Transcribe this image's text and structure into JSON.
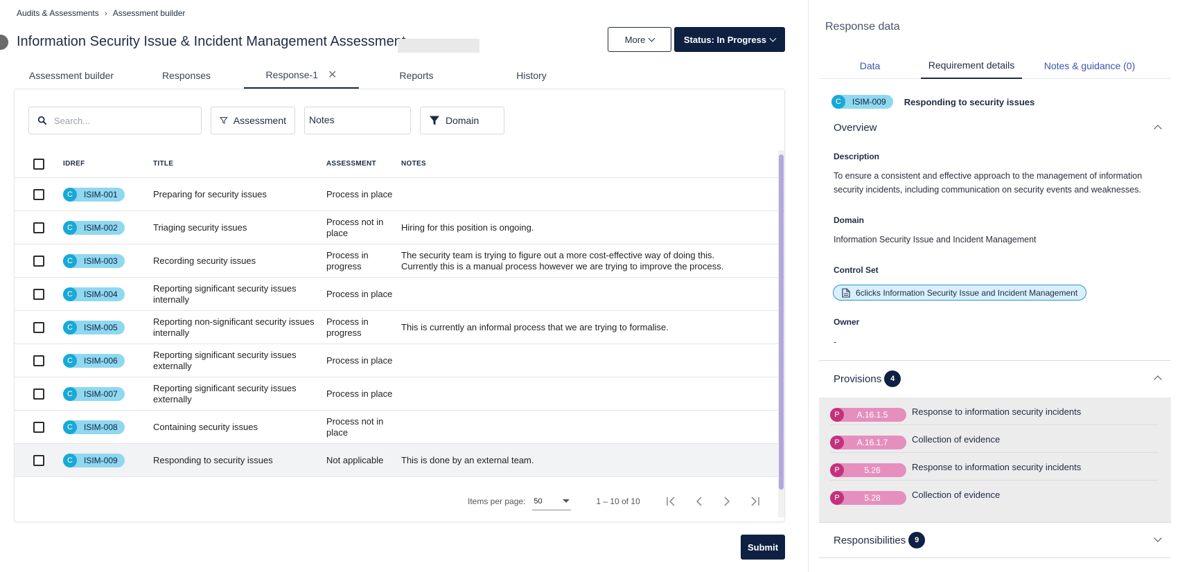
{
  "breadcrumb": {
    "parent": "Audits & Assessments",
    "current": "Assessment builder"
  },
  "page_title": "Information Security Issue & Incident Management Assessment",
  "header_buttons": {
    "more": "More",
    "status": "Status: In Progress"
  },
  "tabs": [
    {
      "label": "Assessment builder"
    },
    {
      "label": "Responses"
    },
    {
      "label": "Response-1",
      "close": "✕"
    },
    {
      "label": "Reports"
    },
    {
      "label": "History"
    }
  ],
  "filters": {
    "search_placeholder": "Search...",
    "assessment": "Assessment",
    "notes": "Notes",
    "domain": "Domain"
  },
  "table": {
    "headers": {
      "idref": "IDREF",
      "title": "TITLE",
      "assessment": "ASSESSMENT",
      "notes": "NOTES"
    },
    "rows": [
      {
        "letter": "C",
        "id": "ISIM-001",
        "title": "Preparing for security issues",
        "assessment": "Process in place",
        "notes": ""
      },
      {
        "letter": "C",
        "id": "ISIM-002",
        "title": "Triaging security issues",
        "assessment": "Process not in place",
        "notes": "Hiring for this position is ongoing."
      },
      {
        "letter": "C",
        "id": "ISIM-003",
        "title": "Recording security issues",
        "assessment": "Process in progress",
        "notes": "The security team is trying to figure out a more cost-effective way of doing this. Currently this is a manual process however we are trying to improve the process."
      },
      {
        "letter": "C",
        "id": "ISIM-004",
        "title": "Reporting significant security issues internally",
        "assessment": "Process in place",
        "notes": ""
      },
      {
        "letter": "C",
        "id": "ISIM-005",
        "title": "Reporting non-significant security issues internally",
        "assessment": "Process in progress",
        "notes": "This is currently an informal process that we are trying to formalise."
      },
      {
        "letter": "C",
        "id": "ISIM-006",
        "title": "Reporting significant security issues externally",
        "assessment": "Process in place",
        "notes": ""
      },
      {
        "letter": "C",
        "id": "ISIM-007",
        "title": "Reporting significant security issues externally",
        "assessment": "Process in place",
        "notes": ""
      },
      {
        "letter": "C",
        "id": "ISIM-008",
        "title": "Containing security issues",
        "assessment": "Process not in place",
        "notes": ""
      },
      {
        "letter": "C",
        "id": "ISIM-009",
        "title": "Responding to security issues",
        "assessment": "Not applicable",
        "notes": "This is done by an external team."
      }
    ]
  },
  "paginator": {
    "items_label": "Items per page:",
    "per_page": "50",
    "range": "1 – 10 of 10"
  },
  "submit_label": "Submit",
  "right_panel": {
    "title": "Response data",
    "tabs": [
      {
        "label": "Data"
      },
      {
        "label": "Requirement details"
      },
      {
        "label": "Notes & guidance (0)"
      }
    ],
    "requirement": {
      "letter": "C",
      "id": "ISIM-009",
      "title": "Responding to security issues"
    },
    "overview": {
      "heading": "Overview",
      "description_label": "Description",
      "description": "To ensure a consistent and effective approach to the management of information security incidents, including communication on security events and weaknesses.",
      "domain_label": "Domain",
      "domain": "Information Security Issue and Incident Management",
      "control_set_label": "Control Set",
      "control_set": "6clicks Information Security Issue and Incident Management",
      "owner_label": "Owner",
      "owner": "-"
    },
    "provisions": {
      "heading": "Provisions",
      "count": "4",
      "items": [
        {
          "letter": "P",
          "code": "A.16.1.5",
          "text": "Response to information security incidents"
        },
        {
          "letter": "P",
          "code": "A.16.1.7",
          "text": "Collection of evidence"
        },
        {
          "letter": "P",
          "code": "5.26",
          "text": "Response to information security incidents"
        },
        {
          "letter": "P",
          "code": "5.28",
          "text": "Collection of evidence"
        }
      ]
    },
    "responsibilities": {
      "heading": "Responsibilities",
      "count": "9"
    }
  }
}
